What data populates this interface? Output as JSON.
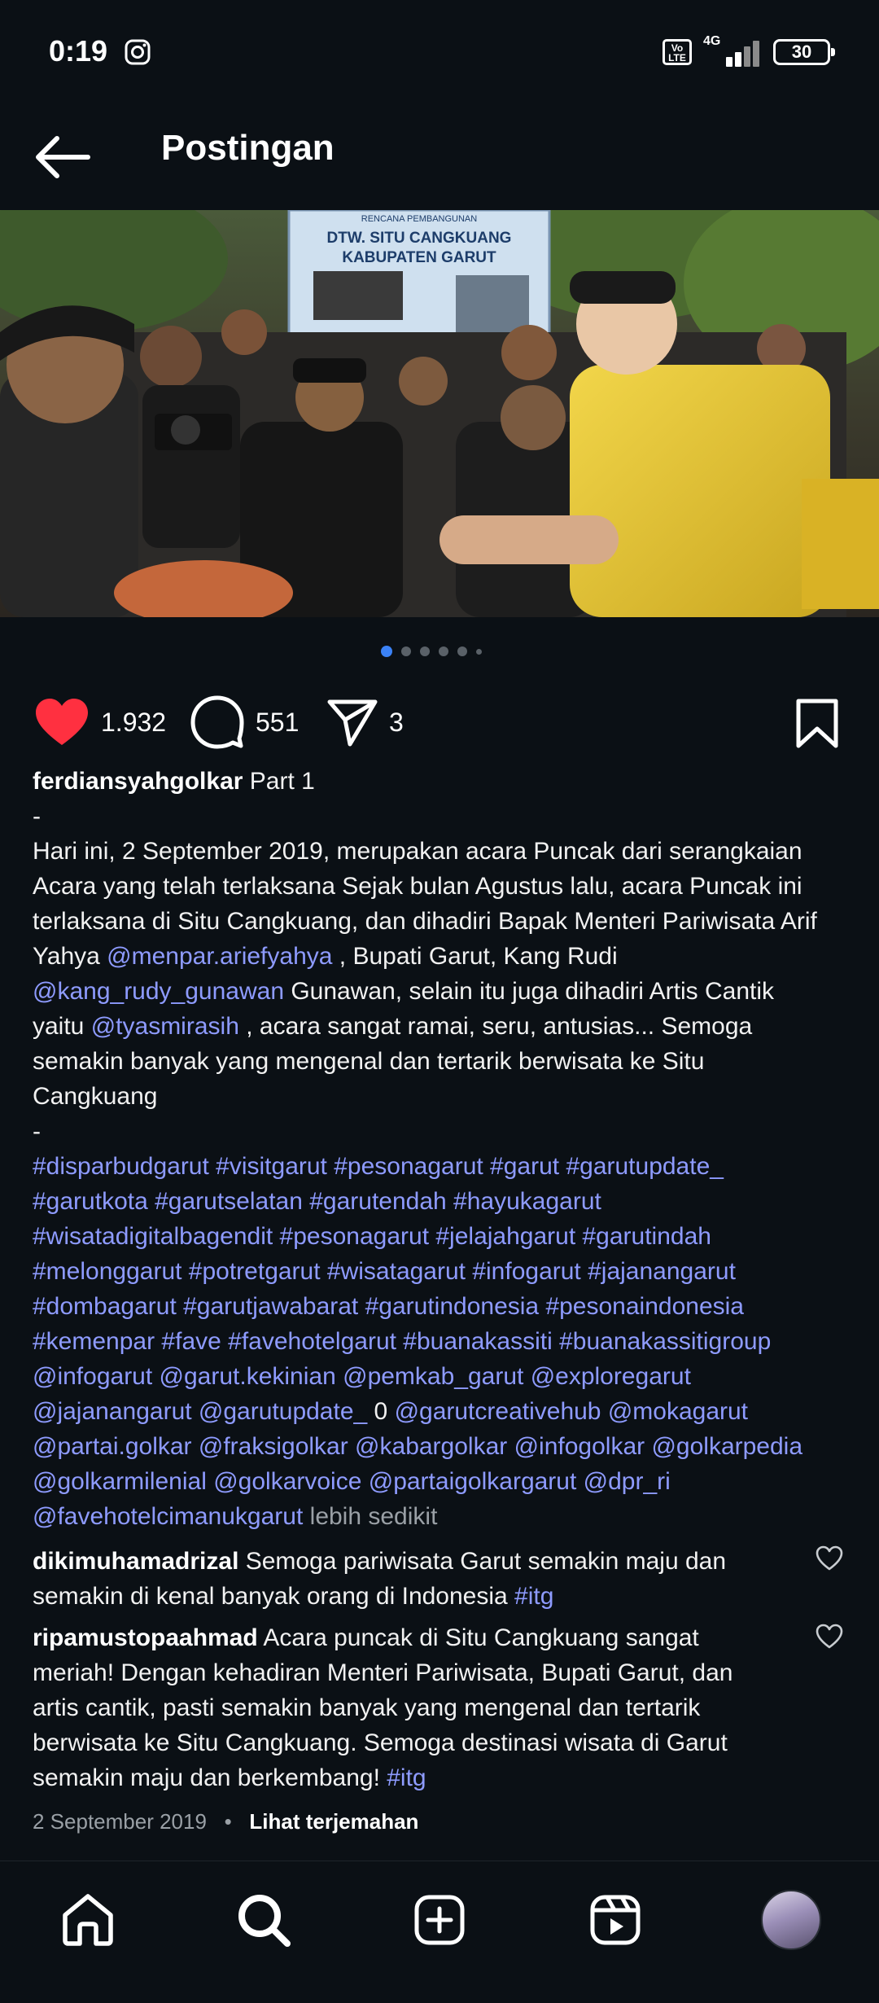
{
  "status_bar": {
    "time": "0:19",
    "volte": "Vo LTE",
    "network": "4G",
    "battery": "30"
  },
  "header": {
    "title": "Postingan"
  },
  "carousel": {
    "count": 6,
    "active": 0
  },
  "actions": {
    "likes": "1.932",
    "comments": "551",
    "shares": "3"
  },
  "caption": {
    "username": "ferdiansyahgolkar",
    "part": "Part 1",
    "dash": "-",
    "t1": "Hari ini, 2 September 2019, merupakan acara Puncak dari serangkaian",
    "t2": "Acara yang telah terlaksana Sejak bulan Agustus lalu, acara Puncak ini",
    "t3": "terlaksana di Situ Cangkuang, dan dihadiri Bapak Menteri Pariwisata Arif",
    "t4a": "Yahya ",
    "m1": "@menpar.ariefyahya",
    "t4b": " , Bupati Garut, Kang Rudi",
    "m2": "@kang_rudy_gunawan",
    "t5b": " Gunawan, selain itu juga dihadiri Artis Cantik",
    "t6a": "yaitu ",
    "m3": "@tyasmirasih",
    "t6b": " , acara sangat ramai, seru, antusias... Semoga",
    "t7": "semakin banyak yang mengenal dan tertarik berwisata ke Situ",
    "t8": "Cangkuang",
    "dash2": "-",
    "tags": [
      "#disparbudgarut #visitgarut #pesonagarut #garut #garutupdate_",
      "#garutkota #garutselatan #garutendah #hayukagarut",
      "#wisatadigitalbagendit #pesonagarut #jelajahgarut #garutindah",
      "#melonggarut #potretgarut #wisatagarut #infogarut #jajanangarut",
      "#dombagarut #garutjawabarat #garutindonesia #pesonaindonesia",
      "#kemenpar #fave #favehotelgarut #buanakassiti #buanakassitigroup",
      "@infogarut @garut.kekinian @pemkab_garut @exploregarut"
    ],
    "tag_line8a": "@jajanangarut @garutupdate_",
    "tag_line8b": " 0 ",
    "tag_line8c": "@garutcreativehub @mokagarut",
    "tags_rest": [
      "@partai.golkar @fraksigolkar @kabargolkar @infogolkar @golkarpedia",
      "@golkarmilenial @golkarvoice @partaigolkargarut @dpr_ri"
    ],
    "last_tag": "@favehotelcimanukgarut",
    "less": " lebih sedikit"
  },
  "comments": [
    {
      "user": "dikimuhamadrizal",
      "text1": " Semoga pariwisata Garut semakin maju dan",
      "text2": "semakin di kenal banyak orang di Indonesia ",
      "tag": "#itg"
    },
    {
      "user": "ripamustopaahmad",
      "text1": " Acara puncak di Situ Cangkuang sangat",
      "text2": "meriah! Dengan kehadiran Menteri Pariwisata, Bupati Garut, dan",
      "text3": "artis cantik, pasti semakin banyak yang mengenal dan tertarik",
      "text4": "berwisata ke Situ Cangkuang. Semoga destinasi wisata di Garut",
      "text5": "semakin maju dan berkembang! ",
      "tag": "#itg"
    }
  ],
  "meta": {
    "date": "2 September 2019",
    "sep": "•",
    "translate": "Lihat terjemahan"
  },
  "photo_banner": {
    "line1": "RENCANA PEMBANGUNAN",
    "line2": "DTW. SITU CANGKUANG",
    "line3": "KABUPATEN GARUT"
  },
  "colors": {
    "background": "#0b1015",
    "link": "#8e9bff",
    "like": "#ff3040",
    "dot_active": "#3b82f6"
  }
}
